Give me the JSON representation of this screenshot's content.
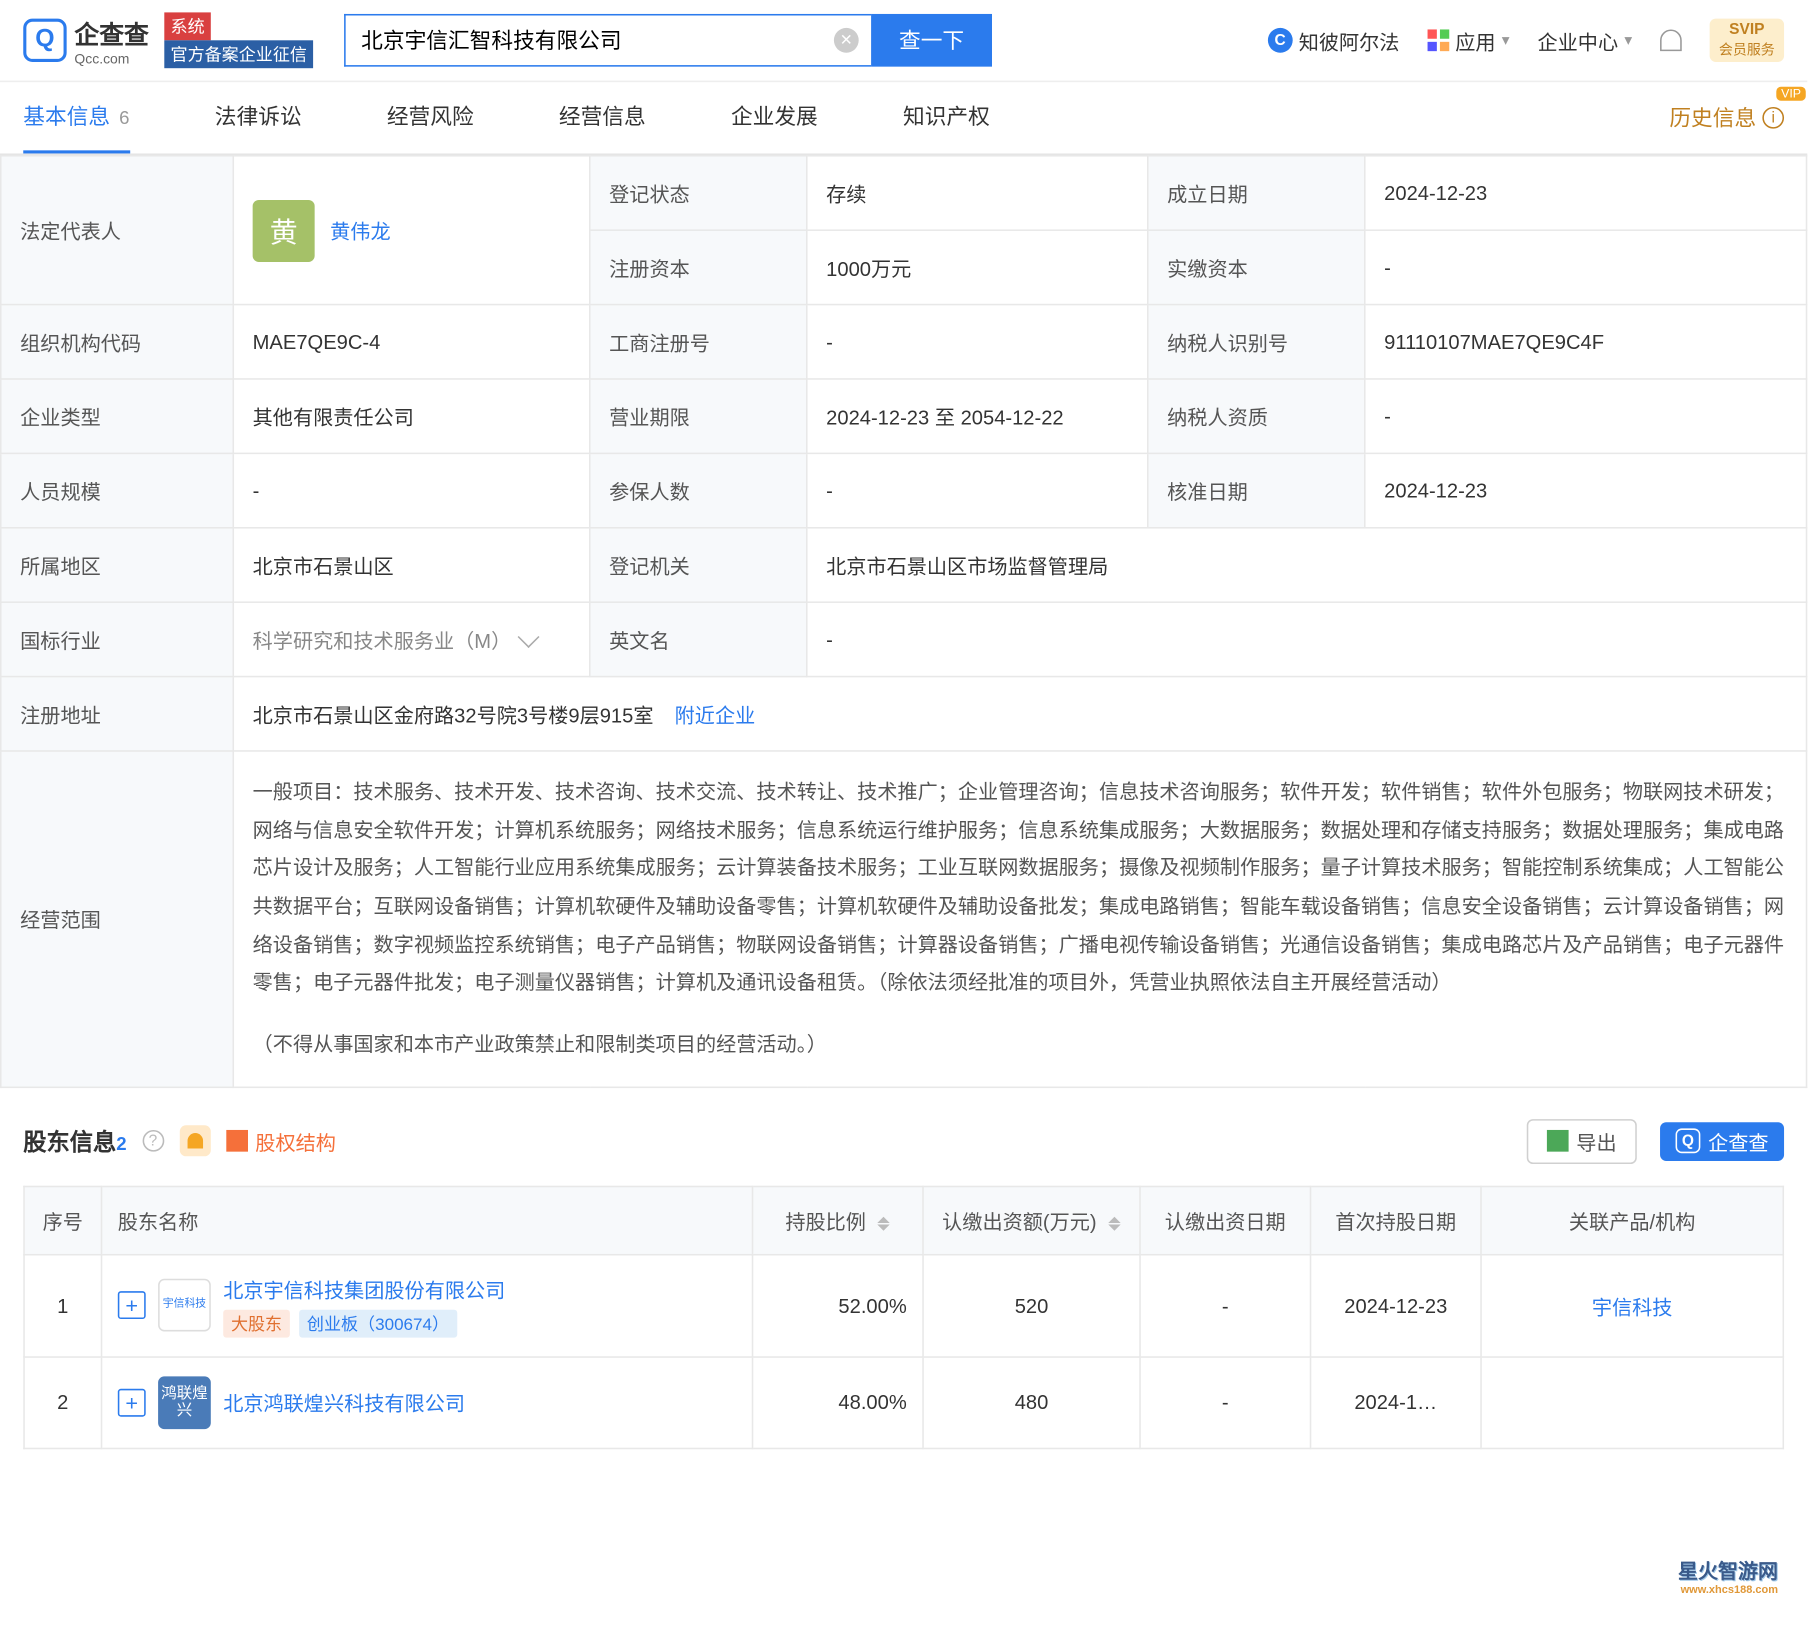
{
  "header": {
    "logo_cn": "企查查",
    "logo_en": "Qcc.com",
    "tag_system": "系统",
    "tag_auth": "官方备案企业征信",
    "search_value": "北京宇信汇智科技有限公司",
    "search_btn": "查一下",
    "zhibi": "知彼阿尔法",
    "app": "应用",
    "enterprise_center": "企业中心",
    "svip_top": "SVIP",
    "svip_bottom": "会员服务"
  },
  "tabs": {
    "basic": "基本信息",
    "basic_count": "6",
    "legal": "法律诉讼",
    "risk": "经营风险",
    "biz_info": "经营信息",
    "dev": "企业发展",
    "ip": "知识产权",
    "history": "历史信息"
  },
  "info": {
    "legal_rep_label": "法定代表人",
    "legal_rep_avatar": "黄",
    "legal_rep_name": "黄伟龙",
    "reg_status_label": "登记状态",
    "reg_status": "存续",
    "found_date_label": "成立日期",
    "found_date": "2024-12-23",
    "reg_capital_label": "注册资本",
    "reg_capital": "1000万元",
    "paid_capital_label": "实缴资本",
    "paid_capital": "-",
    "org_code_label": "组织机构代码",
    "org_code": "MAE7QE9C-4",
    "biz_reg_label": "工商注册号",
    "biz_reg": "-",
    "tax_id_label": "纳税人识别号",
    "tax_id": "91110107MAE7QE9C4F",
    "ent_type_label": "企业类型",
    "ent_type": "其他有限责任公司",
    "biz_term_label": "营业期限",
    "biz_term": "2024-12-23 至 2054-12-22",
    "tax_qual_label": "纳税人资质",
    "tax_qual": "-",
    "staff_size_label": "人员规模",
    "staff_size": "-",
    "insured_label": "参保人数",
    "insured": "-",
    "approve_date_label": "核准日期",
    "approve_date": "2024-12-23",
    "region_label": "所属地区",
    "region": "北京市石景山区",
    "reg_auth_label": "登记机关",
    "reg_auth": "北京市石景山区市场监督管理局",
    "industry_label": "国标行业",
    "industry": "科学研究和技术服务业（M）",
    "en_name_label": "英文名",
    "en_name": "-",
    "address_label": "注册地址",
    "address": "北京市石景山区金府路32号院3号楼9层915室",
    "nearby": "附近企业",
    "scope_label": "经营范围",
    "scope": "一般项目：技术服务、技术开发、技术咨询、技术交流、技术转让、技术推广；企业管理咨询；信息技术咨询服务；软件开发；软件销售；软件外包服务；物联网技术研发；网络与信息安全软件开发；计算机系统服务；网络技术服务；信息系统运行维护服务；信息系统集成服务；大数据服务；数据处理和存储支持服务；数据处理服务；集成电路芯片设计及服务；人工智能行业应用系统集成服务；云计算装备技术服务；工业互联网数据服务；摄像及视频制作服务；量子计算技术服务；智能控制系统集成；人工智能公共数据平台；互联网设备销售；计算机软硬件及辅助设备零售；计算机软硬件及辅助设备批发；集成电路销售；智能车载设备销售；信息安全设备销售；云计算设备销售；网络设备销售；数字视频监控系统销售；电子产品销售；物联网设备销售；计算器设备销售；广播电视传输设备销售；光通信设备销售；集成电路芯片及产品销售；电子元器件零售；电子元器件批发；电子测量仪器销售；计算机及通讯设备租赁。（除依法须经批准的项目外，凭营业执照依法自主开展经营活动）",
    "scope_extra": "（不得从事国家和本市产业政策禁止和限制类项目的经营活动。）"
  },
  "shareholders": {
    "title": "股东信息",
    "count": "2",
    "equity_structure": "股权结构",
    "export": "导出",
    "qcc_badge": "企查查",
    "cols": {
      "index": "序号",
      "name": "股东名称",
      "ratio": "持股比例",
      "amount": "认缴出资额(万元)",
      "contrib_date": "认缴出资日期",
      "first_hold_date": "首次持股日期",
      "related": "关联产品/机构"
    },
    "rows": [
      {
        "index": "1",
        "logo_text": "宇信科技",
        "logo_style": "yuxin",
        "name": "北京宇信科技集团股份有限公司",
        "tag_major": "大股东",
        "tag_board": "创业板（300674）",
        "ratio": "52.00%",
        "amount": "520",
        "contrib_date": "-",
        "first_hold_date": "2024-12-23",
        "related": "宇信科技"
      },
      {
        "index": "2",
        "logo_text": "鸿联煌兴",
        "logo_style": "honglian",
        "name": "北京鸿联煌兴科技有限公司",
        "tag_major": "",
        "tag_board": "",
        "ratio": "48.00%",
        "amount": "480",
        "contrib_date": "-",
        "first_hold_date": "2024-1…",
        "related": ""
      }
    ]
  },
  "watermark": {
    "main": "星火智游网",
    "sub": "www.xhcs188.com"
  }
}
